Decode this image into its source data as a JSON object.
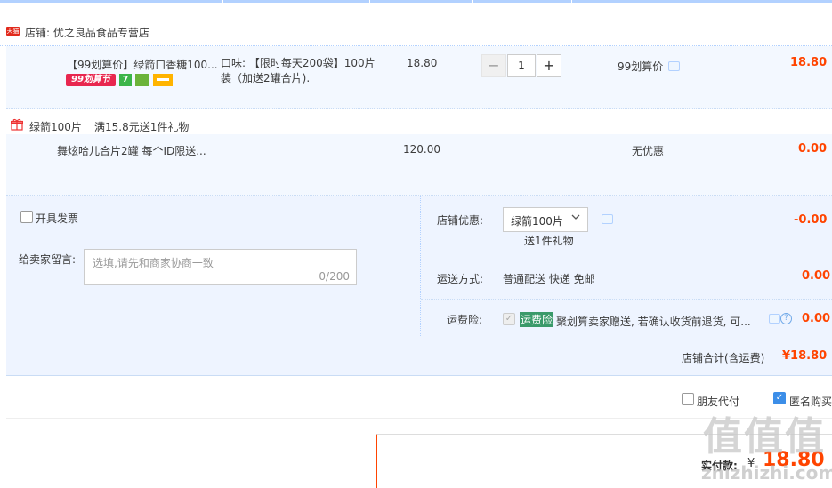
{
  "shop": {
    "label": "店铺: 优之良品食品专营店",
    "badge": "天猫"
  },
  "item": {
    "title": "【99划算价】绿箭口香糖100...",
    "flavor": "口味: 【限时每天200袋】100片装（加送2罐合片).",
    "unit_price": "18.80",
    "quantity": "1",
    "promo": "99划算价",
    "subtotal": "18.80",
    "badge_99": "99划算节",
    "badge_7": "7"
  },
  "promotion": {
    "title": "绿箭100片",
    "rule": "满15.8元送1件礼物"
  },
  "gift": {
    "title": "舞炫哈儿合片2罐 每个ID限送...",
    "price": "120.00",
    "promo": "无优惠",
    "subtotal": "0.00"
  },
  "invoice": {
    "label": "开具发票"
  },
  "message": {
    "label": "给卖家留言:",
    "placeholder": "选填,请先和商家协商一致",
    "counter": "0/200"
  },
  "shop_discount": {
    "label": "店铺优惠:",
    "selected": "绿箭100片",
    "note": "送1件礼物",
    "amount": "-0.00"
  },
  "shipping": {
    "label": "运送方式:",
    "value": "普通配送 快递 免邮",
    "amount": "0.00"
  },
  "insurance": {
    "label": "运费险:",
    "tag": "运费险",
    "text": "聚划算卖家赠送, 若确认收货前退货, 可...",
    "amount": "0.00"
  },
  "total": {
    "label": "店铺合计(含运费)",
    "amount": "¥18.80"
  },
  "options": {
    "friend_pay": "朋友代付",
    "anonymous": "匿名购买"
  },
  "pay": {
    "label": "实付款:",
    "currency": "¥",
    "amount": "18.80"
  },
  "watermark": {
    "text": "值值值",
    "domain": "zhizhizhi.com"
  }
}
